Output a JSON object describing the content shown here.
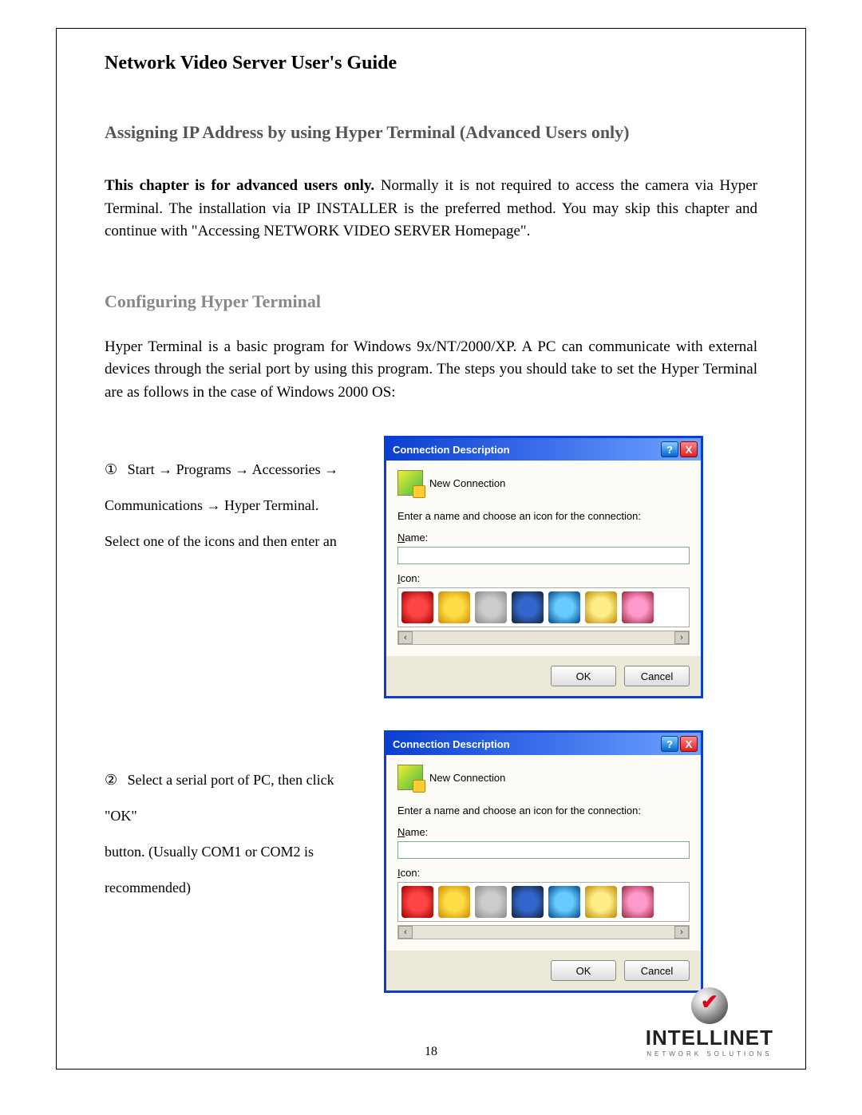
{
  "doc_title": "Network Video Server User's Guide",
  "chapter_title": "Assigning IP Address by using Hyper Terminal (Advanced Users only)",
  "intro_bold": "This chapter is for advanced users only.",
  "intro_rest": " Normally it is not required to access the camera via Hyper Terminal. The installation via IP INSTALLER is the preferred method. You may skip this chapter and continue with \"Accessing NETWORK VIDEO SERVER Homepage\".",
  "section_title": "Configuring Hyper Terminal",
  "section_para": "Hyper Terminal is a basic program for Windows 9x/NT/2000/XP. A PC can communicate with external devices through the serial port by using this program. The steps you should take to set the Hyper Terminal are as follows in the case of Windows 2000 OS:",
  "steps": [
    {
      "enum": "①",
      "lines": [
        "Start → Programs → Accessories →",
        "Communications → Hyper Terminal.",
        "Select one of the icons and then enter an"
      ]
    },
    {
      "enum": "②",
      "lines": [
        "Select a serial port of PC, then click    \"OK\"",
        "button.    (Usually    COM1 or    COM2 is",
        "recommended)"
      ]
    }
  ],
  "dialog": {
    "title": "Connection Description",
    "new_conn": "New Connection",
    "prompt": "Enter a name and choose an icon for the connection:",
    "name_label_u": "N",
    "name_label_rest": "ame:",
    "name_value": "",
    "icon_label_u": "I",
    "icon_label_rest": "con:",
    "ok": "OK",
    "cancel": "Cancel",
    "help": "?",
    "close": "X",
    "scroll_left": "‹",
    "scroll_right": "›"
  },
  "page_number": "18",
  "brand": {
    "name": "INTELLINET",
    "sub": "NETWORK SOLUTIONS"
  }
}
